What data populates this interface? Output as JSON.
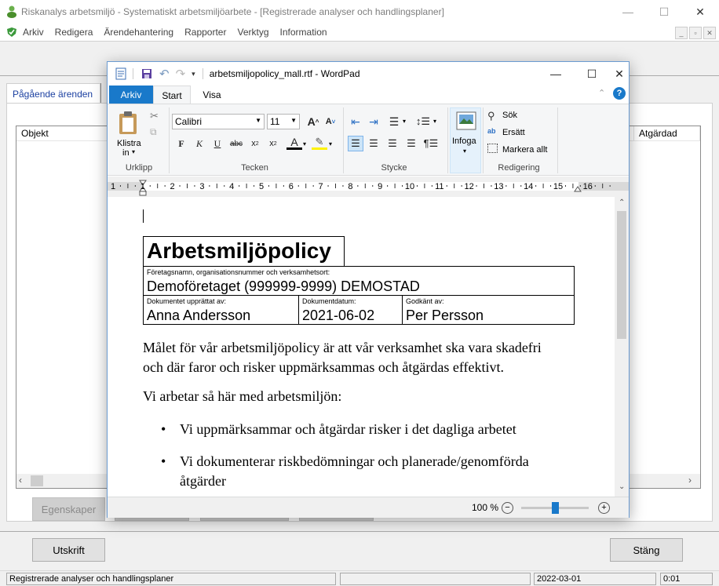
{
  "outer": {
    "title": "Riskanalys arbetsmiljö - Systematiskt arbetsmiljöarbete - [Registrerade analyser och handlingsplaner]",
    "menu": [
      "Arkiv",
      "Redigera",
      "Ärendehantering",
      "Rapporter",
      "Verktyg",
      "Information"
    ],
    "tab_active": "Pågående ärenden",
    "col_objekt": "Objekt",
    "col_atgardad": "Atgärdad",
    "btn_egenskaper": "Egenskaper",
    "btn_utskrift": "Utskrift",
    "btn_stang": "Stäng",
    "status_left": "Registrerade analyser och handlingsplaner",
    "status_date": "2022-03-01",
    "status_time": "0:01"
  },
  "wordpad": {
    "title": "arbetsmiljopolicy_mall.rtf - WordPad",
    "tab_arkiv": "Arkiv",
    "tab_start": "Start",
    "tab_visa": "Visa",
    "paste_label": "Klistra",
    "paste_label2": "in",
    "font_name": "Calibri",
    "font_size": "11",
    "insert_label": "Infoga",
    "find_label": "Sök",
    "replace_label": "Ersätt",
    "selectall_label": "Markera allt",
    "group_clipboard": "Urklipp",
    "group_font": "Tecken",
    "group_paragraph": "Stycke",
    "group_editing": "Redigering",
    "ruler_numbers": [
      "1",
      "1",
      "2",
      "3",
      "4",
      "5",
      "6",
      "7",
      "8",
      "9",
      "10",
      "11",
      "12",
      "13",
      "14",
      "15",
      "16"
    ],
    "zoom": "100 %",
    "zoom_level": 0.5
  },
  "document": {
    "heading": "Arbetsmiljöpolicy",
    "company_label": "Företagsnamn, organisationsnummer och verksamhetsort:",
    "company_value": "Demoföretaget  (999999-9999)  DEMOSTAD",
    "author_label": "Dokumentet  upprättat av:",
    "author_value": "Anna Andersson",
    "date_label": "Dokumentdatum:",
    "date_value": "2021-06-02",
    "approved_label": "Godkänt av:",
    "approved_value": "Per Persson",
    "para1_line1": "Målet  för vår arbetsmiljöpolicy  är att vår verksamhet ska vara skadefri",
    "para1_line2": "och där faror och risker uppmärksammas och åtgärdas effektivt.",
    "para2": "Vi arbetar så här med arbetsmiljön:",
    "bullet1": "Vi uppmärksammar och åtgärdar risker  i det dagliga  arbetet",
    "bullet2_line1": "Vi dokumenterar  riskbedömningar  och planerade/genomförda",
    "bullet2_line2": "åtgärder"
  },
  "colors": {
    "accent": "#2b6fc4",
    "doc_blue": "#1a3fa0"
  }
}
